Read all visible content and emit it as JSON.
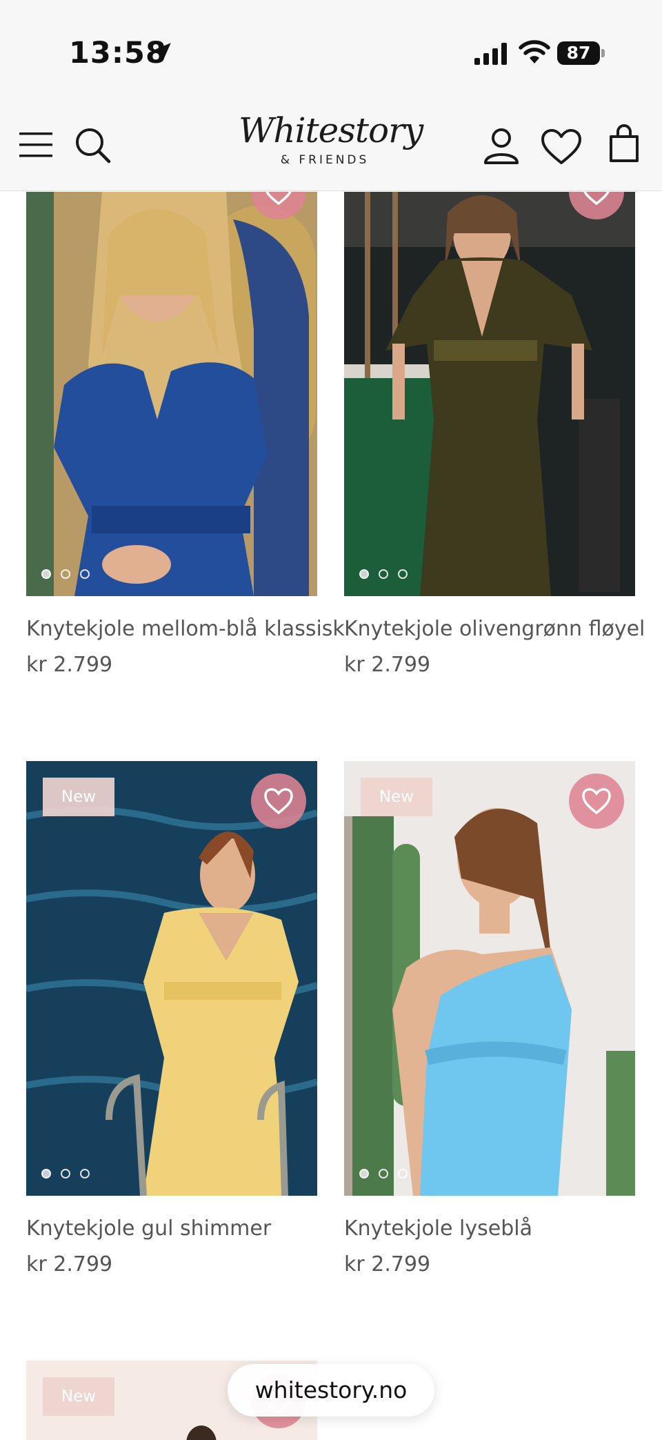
{
  "status_bar": {
    "time": "13:58",
    "battery": "87"
  },
  "header": {
    "logo_script": "Whitestory",
    "logo_sub": "& FRIENDS"
  },
  "products": [
    {
      "name": "Knytekjole mellom-blå klassisk",
      "price": "kr 2.799",
      "badge": "",
      "dress_color": "#1f4f9a"
    },
    {
      "name": "Knytekjole olivengrønn fløyel",
      "price": "kr 2.799",
      "badge": "",
      "dress_color": "#3d3a1e"
    },
    {
      "name": "Knytekjole gul shimmer",
      "price": "kr 2.799",
      "badge": "New",
      "dress_color": "#f0d27a"
    },
    {
      "name": "Knytekjole lyseblå",
      "price": "kr 2.799",
      "badge": "New",
      "dress_color": "#6fc6ee"
    },
    {
      "name": "",
      "price": "",
      "badge": "New",
      "dress_color": "#e8d2c4"
    }
  ],
  "browser": {
    "url": "whitestory.no"
  },
  "colors": {
    "favorite_button": "#de8493",
    "new_badge": "#eed2ce",
    "header_bg": "#f7f7f8"
  }
}
